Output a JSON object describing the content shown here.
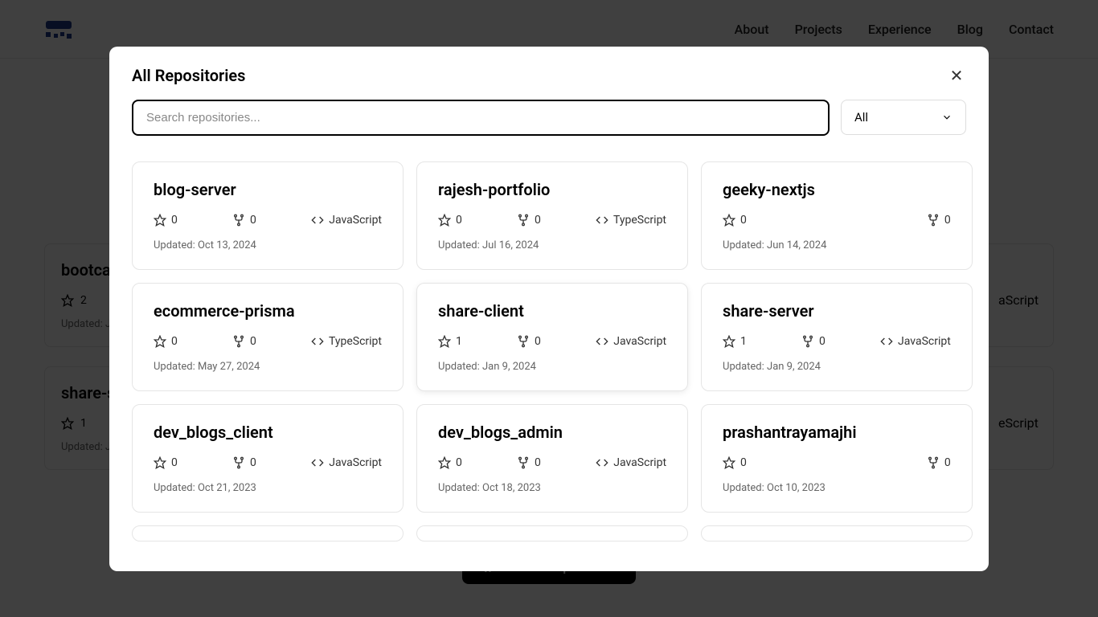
{
  "header": {
    "nav": [
      "About",
      "Projects",
      "Experience",
      "Blog",
      "Contact"
    ]
  },
  "bg": {
    "card1_title": "bootcan",
    "card1_stars": "2",
    "card1_updated": "Updated: Ja",
    "card2_title": "share-se",
    "card2_stars": "1",
    "card2_updated": "Updated: Ja",
    "lang_right1": "aScript",
    "lang_right2": "eScript",
    "button_label": "View All Repositories"
  },
  "modal": {
    "title": "All Repositories",
    "search_placeholder": "Search repositories...",
    "filter_selected": "All"
  },
  "repos": [
    {
      "name": "blog-server",
      "stars": "0",
      "forks": "0",
      "lang": "JavaScript",
      "updated": "Updated: Oct 13, 2024"
    },
    {
      "name": "rajesh-portfolio",
      "stars": "0",
      "forks": "0",
      "lang": "TypeScript",
      "updated": "Updated: Jul 16, 2024"
    },
    {
      "name": "geeky-nextjs",
      "stars": "0",
      "forks": "0",
      "lang": "",
      "updated": "Updated: Jun 14, 2024"
    },
    {
      "name": "ecommerce-prisma",
      "stars": "0",
      "forks": "0",
      "lang": "TypeScript",
      "updated": "Updated: May 27, 2024"
    },
    {
      "name": "share-client",
      "stars": "1",
      "forks": "0",
      "lang": "JavaScript",
      "updated": "Updated: Jan 9, 2024",
      "hovered": true
    },
    {
      "name": "share-server",
      "stars": "1",
      "forks": "0",
      "lang": "JavaScript",
      "updated": "Updated: Jan 9, 2024"
    },
    {
      "name": "dev_blogs_client",
      "stars": "0",
      "forks": "0",
      "lang": "JavaScript",
      "updated": "Updated: Oct 21, 2023"
    },
    {
      "name": "dev_blogs_admin",
      "stars": "0",
      "forks": "0",
      "lang": "JavaScript",
      "updated": "Updated: Oct 18, 2023"
    },
    {
      "name": "prashantrayamajhi",
      "stars": "0",
      "forks": "0",
      "lang": "",
      "updated": "Updated: Oct 10, 2023"
    }
  ]
}
